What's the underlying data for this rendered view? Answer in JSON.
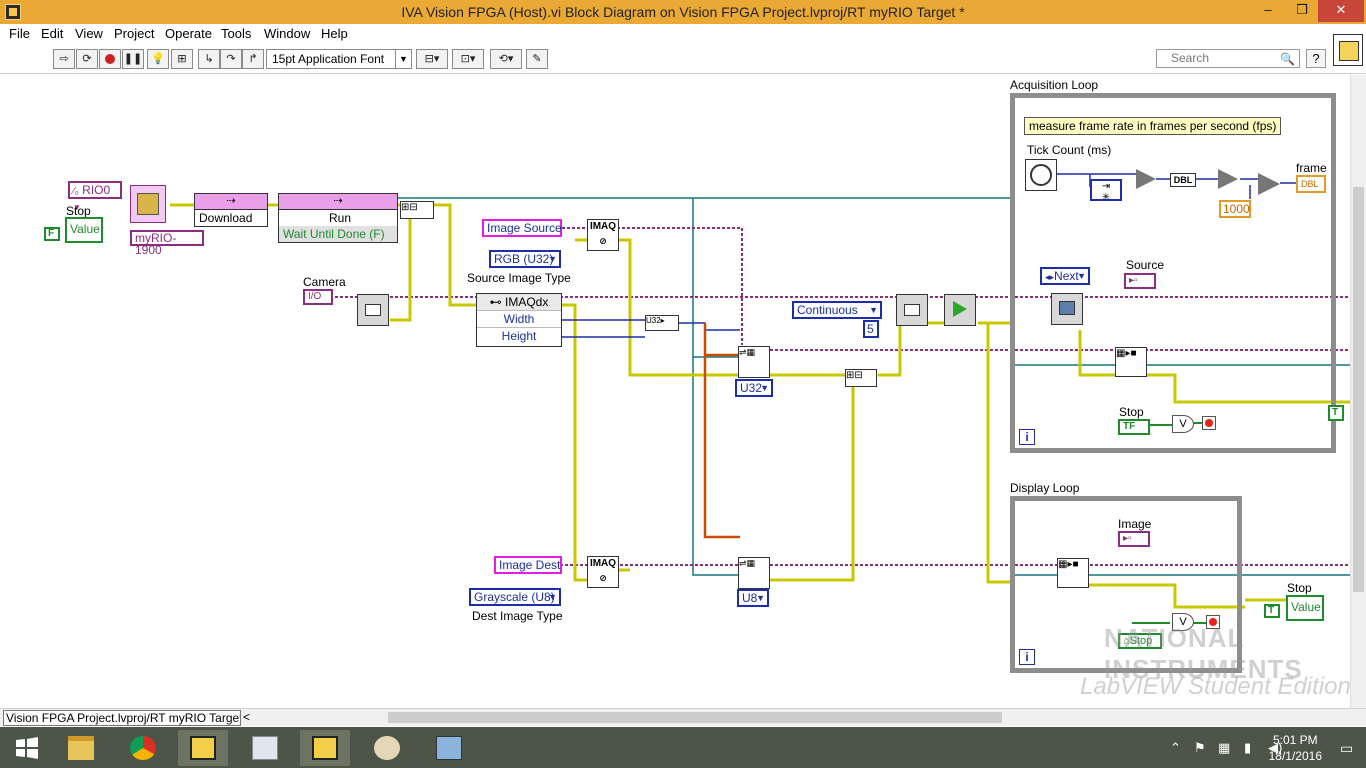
{
  "window": {
    "title": "IVA Vision FPGA (Host).vi Block Diagram on Vision FPGA Project.lvproj/RT myRIO Target *",
    "minimize": "–",
    "restore": "❒",
    "close": "✕"
  },
  "menu": [
    "File",
    "Edit",
    "View",
    "Project",
    "Operate",
    "Tools",
    "Window",
    "Help"
  ],
  "toolbar": {
    "font": "15pt Application Font",
    "search_placeholder": "Search",
    "help": "?"
  },
  "diagram": {
    "rio_resource": "RIO0",
    "stop_label": "Stop",
    "stop_value": "Value",
    "false_const": "F",
    "target": "myRIO-1900",
    "download": "Download",
    "run": "Run",
    "wait_until_done": "Wait Until Done (F)",
    "camera": "Camera",
    "camera_io": "I/O",
    "image_source": "Image Source",
    "source_type_value": "RGB (U32)",
    "source_type_label": "Source Image Type",
    "imaqdx": "IMAQdx",
    "width": "Width",
    "height": "Height",
    "imaq": "IMAQ",
    "u32": "U32",
    "u8": "U8",
    "mode": "Continuous",
    "buffers": "5",
    "image_dest": "Image Dest",
    "dest_type_value": "Grayscale (U8)",
    "dest_type_label": "Dest Image Type",
    "acq_loop": "Acquisition Loop",
    "acq_note": "measure frame rate in frames per second (fps)",
    "tick_count": "Tick Count (ms)",
    "frame": "frame",
    "dbl": "DBL",
    "thousand": "1000",
    "next": "Next",
    "source": "Source",
    "stop_tf": "TF",
    "loop_i": "i",
    "true_const": "T",
    "display_loop": "Display Loop",
    "image": "Image",
    "stop_ref": "Stop"
  },
  "watermark": {
    "brand": "NATIONAL INSTRUMENTS",
    "edition": "LabVIEW Student Edition"
  },
  "status": {
    "context": "Vision FPGA Project.lvproj/RT myRIO Target"
  },
  "taskbar": {
    "time": "5:01 PM",
    "date": "18/1/2016"
  }
}
